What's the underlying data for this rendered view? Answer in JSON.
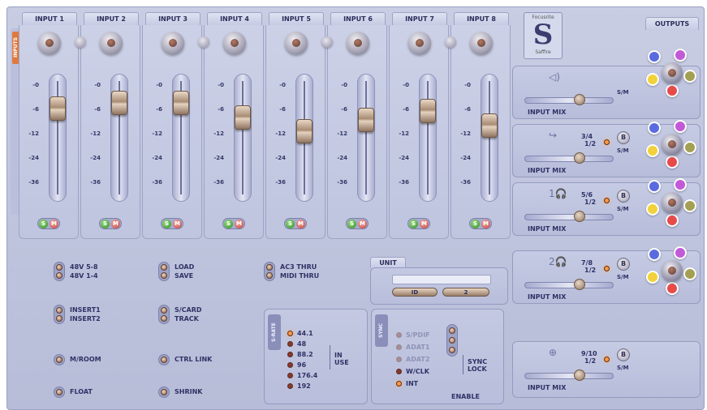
{
  "inputs": [
    {
      "label": "INPUT 1",
      "fader": 0.25
    },
    {
      "label": "INPUT 2",
      "fader": 0.2
    },
    {
      "label": "INPUT 3",
      "fader": 0.2
    },
    {
      "label": "INPUT 4",
      "fader": 0.33
    },
    {
      "label": "INPUT 5",
      "fader": 0.45
    },
    {
      "label": "INPUT 6",
      "fader": 0.35
    },
    {
      "label": "INPUT 7",
      "fader": 0.27
    },
    {
      "label": "INPUT 8",
      "fader": 0.4
    }
  ],
  "scale": [
    "-0",
    "-6",
    "-12",
    "-24",
    "-36"
  ],
  "solo_label": "S",
  "mute_label": "M",
  "side_tab": "INPUTS",
  "toggles_col1": [
    {
      "labels": [
        "48V 5-8",
        "48V 1-4"
      ]
    },
    {
      "labels": [
        "INSERT1",
        "INSERT2"
      ]
    },
    {
      "labels": [
        "M/ROOM"
      ]
    },
    {
      "labels": [
        "FLOAT"
      ]
    }
  ],
  "toggles_col2": [
    {
      "labels": [
        "LOAD",
        "SAVE"
      ]
    },
    {
      "labels": [
        "S/CARD",
        "TRACK"
      ]
    },
    {
      "labels": [
        "CTRL LINK"
      ]
    },
    {
      "labels": [
        "SHRINK"
      ]
    }
  ],
  "toggles_col3": [
    {
      "labels": [
        "AC3 THRU",
        "MIDI THRU"
      ]
    }
  ],
  "unit": {
    "tab": "UNIT",
    "id_label": "ID",
    "btn2_label": "2"
  },
  "samplerate": {
    "tab": "S-RATE",
    "rates": [
      "44.1",
      "48",
      "88.2",
      "96",
      "176.4",
      "192"
    ],
    "in_use": "IN USE"
  },
  "sync": {
    "tab": "SYNC",
    "sources": [
      "S/PDIF",
      "ADAT1",
      "ADAT2",
      "W/CLK",
      "INT"
    ],
    "sync_lock": "SYNC LOCK",
    "enable": "ENABLE"
  },
  "logo": {
    "brand": "Focusrite",
    "sub": "Saffire"
  },
  "outputs": {
    "tab": "OUTPUTS",
    "input_mix": "INPUT MIX",
    "s_m": "S/M",
    "blocks": [
      {
        "ch_top": "",
        "ch_bot": "",
        "icon": "speaker-icon",
        "icon_text": "◁)",
        "mix": 0.6
      },
      {
        "ch_top": "3/4",
        "ch_bot": "1/2",
        "icon": "headphone-icon",
        "icon_text": "↪",
        "mix": 0.6,
        "btn": "B"
      },
      {
        "ch_top": "5/6",
        "ch_bot": "1/2",
        "icon": "headphone-icon",
        "icon_text": "1🎧",
        "mix": 0.6,
        "btn": "B"
      },
      {
        "ch_top": "7/8",
        "ch_bot": "1/2",
        "icon": "headphone-icon",
        "icon_text": "2🎧",
        "mix": 0.6,
        "btn": "B"
      },
      {
        "ch_top": "9/10",
        "ch_bot": "1/2",
        "icon": "digital-out-icon",
        "icon_text": "⊕",
        "mix": 0.6,
        "btn": "B"
      }
    ]
  },
  "colors": {
    "petal_blue": "#5a6be0",
    "petal_purple": "#c25ad8",
    "petal_yellow": "#f1d23a",
    "petal_red": "#e84a4a",
    "petal_olive": "#a3a054"
  }
}
